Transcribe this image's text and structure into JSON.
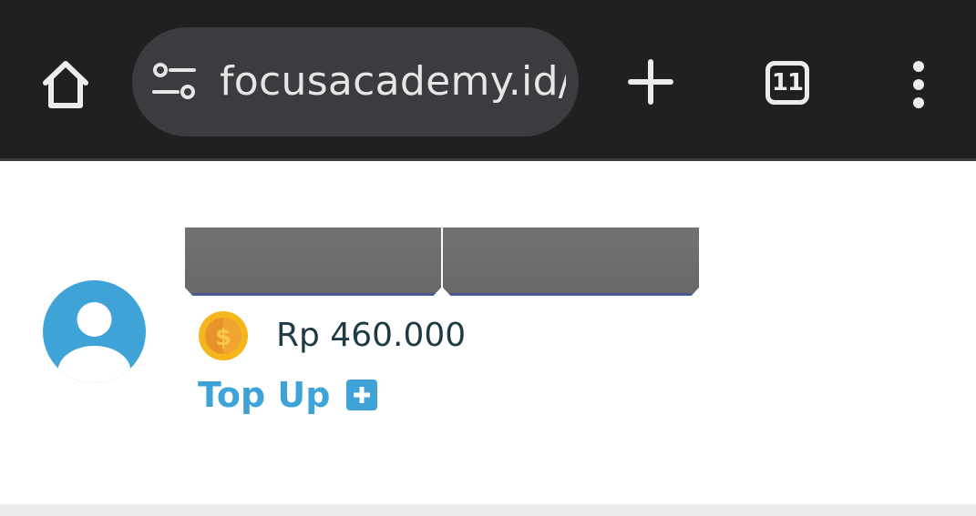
{
  "browser": {
    "url": "focusacademy.id/",
    "tab_count": "11",
    "icons": {
      "home": "home-icon",
      "site_info": "tune-icon",
      "new_tab": "plus-icon",
      "tabs": "tab-switcher-icon",
      "menu": "more-vert-icon"
    }
  },
  "profile": {
    "avatar_icon": "user-avatar-icon",
    "balance": "Rp 460.000",
    "coin_icon": "coin-dollar-icon",
    "topup_label": "Top Up",
    "topup_icon": "plus-square-icon"
  },
  "colors": {
    "toolbar_bg": "#202020",
    "omnibox_bg": "#3b3c3f",
    "accent": "#3fa3d7",
    "balance_text": "#1e3a45",
    "coin": "#f5b51c"
  }
}
